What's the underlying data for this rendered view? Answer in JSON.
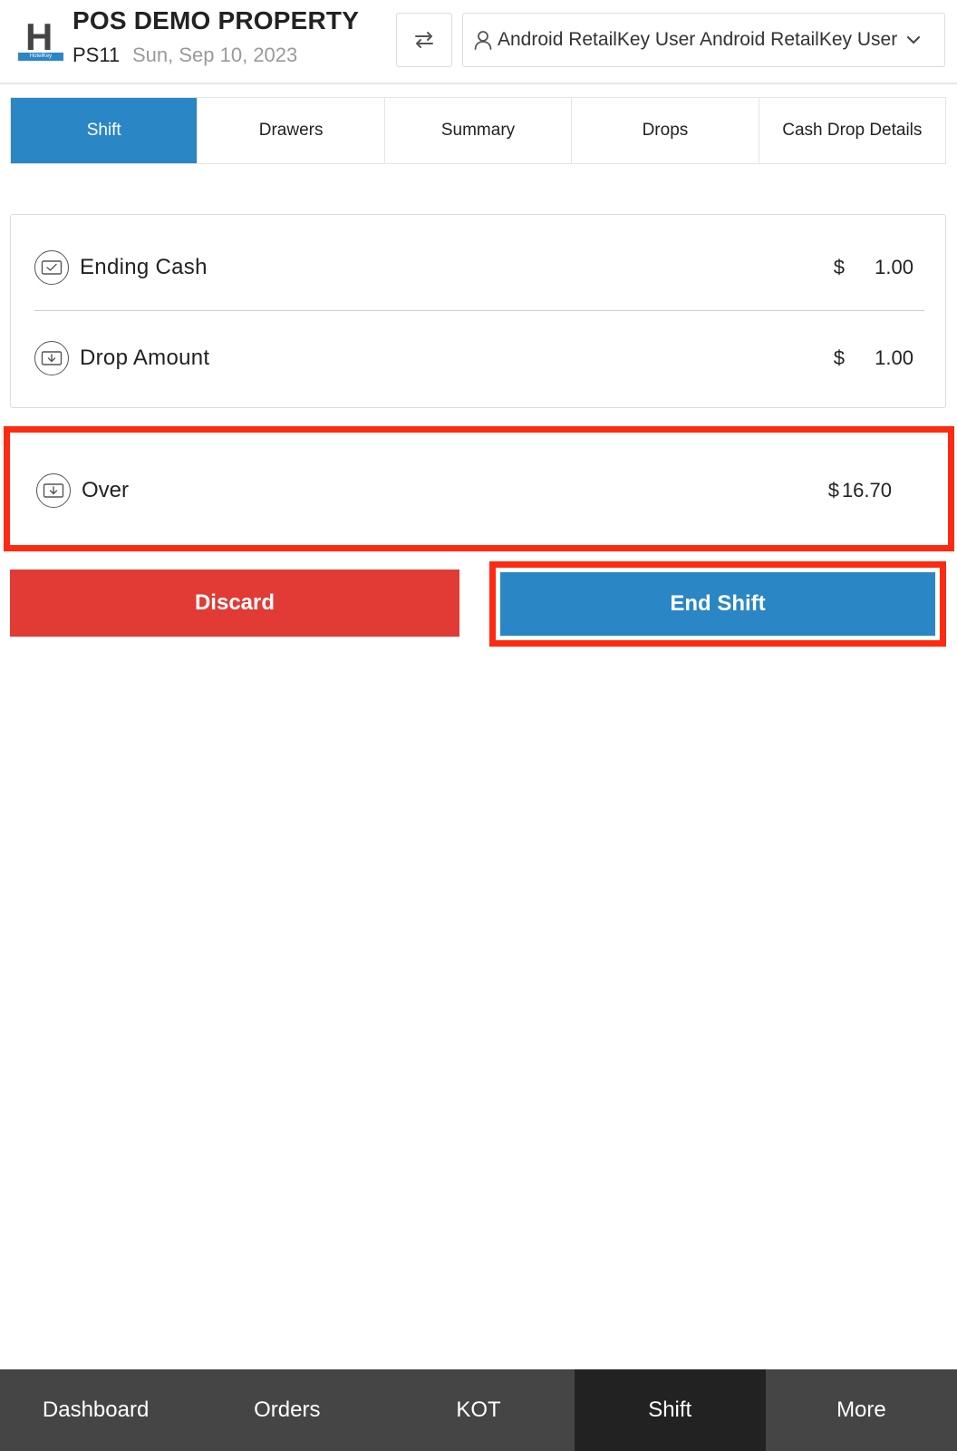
{
  "header": {
    "logo_letter": "H",
    "logo_sub": "HotelKey",
    "property_name": "POS DEMO PROPERTY",
    "property_code": "PS11",
    "date": "Sun, Sep 10, 2023",
    "swap_icon": "swap-arrows-icon",
    "user_icon": "user-icon",
    "user_name": "Android RetailKey User Android RetailKey User",
    "chevron_icon": "chevron-down-icon"
  },
  "tabs": [
    {
      "label": "Shift",
      "active": true
    },
    {
      "label": "Drawers",
      "active": false
    },
    {
      "label": "Summary",
      "active": false
    },
    {
      "label": "Drops",
      "active": false
    },
    {
      "label": "Cash Drop Details",
      "active": false
    }
  ],
  "summary": {
    "ending_cash": {
      "label": "Ending Cash",
      "currency": "$",
      "amount": "1.00"
    },
    "drop_amount": {
      "label": "Drop Amount",
      "currency": "$",
      "amount": "1.00"
    },
    "over": {
      "label": "Over",
      "currency": "$",
      "amount": "16.70"
    }
  },
  "actions": {
    "discard_label": "Discard",
    "end_shift_label": "End Shift"
  },
  "bottom_nav": [
    {
      "label": "Dashboard",
      "active": false
    },
    {
      "label": "Orders",
      "active": false
    },
    {
      "label": "KOT",
      "active": false
    },
    {
      "label": "Shift",
      "active": true
    },
    {
      "label": "More",
      "active": false
    }
  ],
  "colors": {
    "accent": "#2a86c4",
    "danger": "#e23a35",
    "highlight": "#ff2a12",
    "nav_bg": "#454545",
    "nav_active": "#222222"
  }
}
